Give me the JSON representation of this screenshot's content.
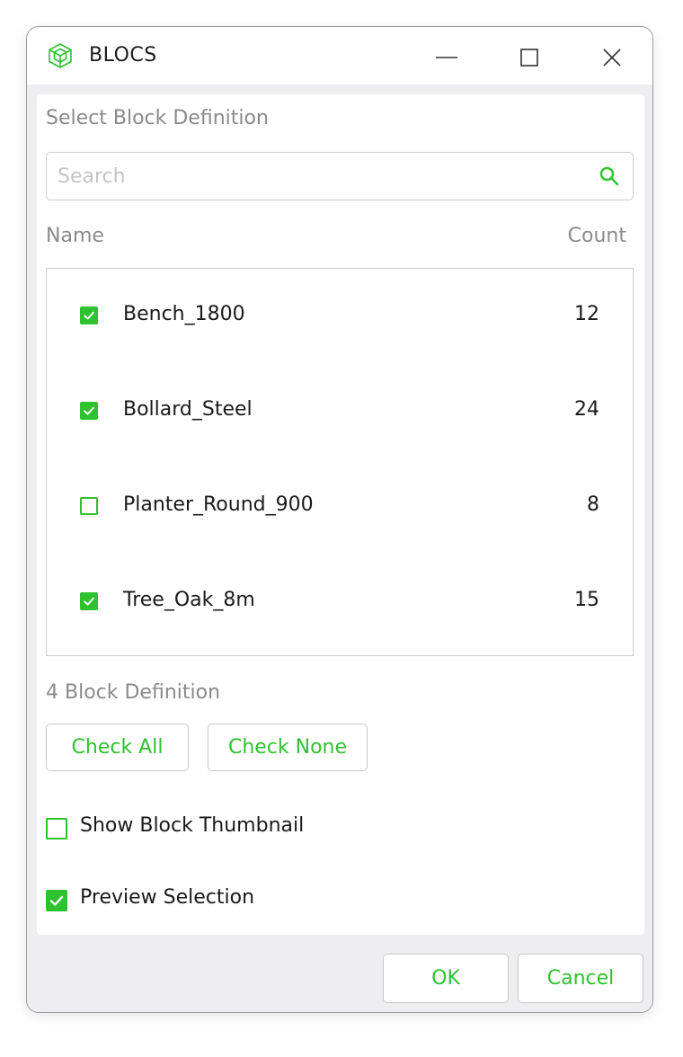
{
  "window": {
    "title": "BLOCS",
    "icon": "cube-icon",
    "controls": [
      "minimize-icon",
      "maximize-icon",
      "close-icon"
    ]
  },
  "panel": {
    "section_label": "Select Block Definition",
    "search": {
      "placeholder": "Search",
      "value": "",
      "icon": "search-icon"
    },
    "columns": {
      "name": "Name",
      "count": "Count"
    },
    "items": [
      {
        "name": "Bench_1800",
        "count": "12",
        "checked": true
      },
      {
        "name": "Bollard_Steel",
        "count": "24",
        "checked": true
      },
      {
        "name": "Planter_Round_900",
        "count": "8",
        "checked": false
      },
      {
        "name": "Tree_Oak_8m",
        "count": "15",
        "checked": true
      }
    ],
    "definition_count": "4",
    "definition_label": "Block Definition",
    "check_all_label": "Check All",
    "check_none_label": "Check None",
    "show_thumbnail": {
      "label": "Show Block Thumbnail",
      "checked": false
    },
    "preview_selection": {
      "label": "Preview Selection",
      "checked": true
    }
  },
  "footer": {
    "ok_label": "OK",
    "cancel_label": "Cancel"
  },
  "colors": {
    "accent": "#2ec22e",
    "muted_text": "#8a8a8a",
    "border": "#cfcfcf"
  }
}
